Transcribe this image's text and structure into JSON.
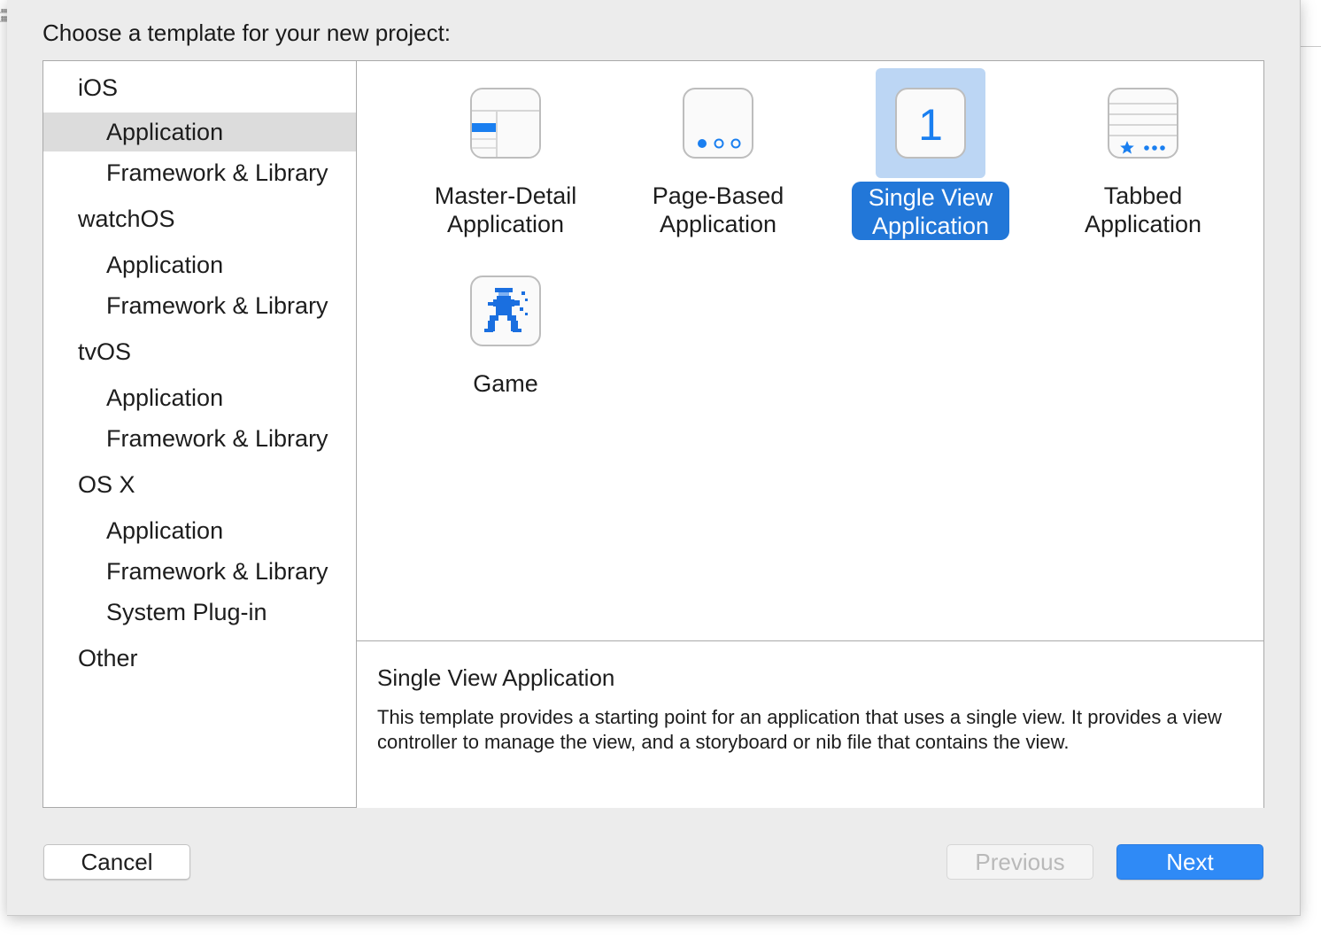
{
  "window": {
    "prompt": "Choose a template for your new project:"
  },
  "sidebar": {
    "items": [
      {
        "label": "iOS",
        "type": "header"
      },
      {
        "label": "Application",
        "type": "item",
        "selected": true
      },
      {
        "label": "Framework & Library",
        "type": "item"
      },
      {
        "label": "watchOS",
        "type": "header"
      },
      {
        "label": "Application",
        "type": "item"
      },
      {
        "label": "Framework & Library",
        "type": "item"
      },
      {
        "label": "tvOS",
        "type": "header"
      },
      {
        "label": "Application",
        "type": "item"
      },
      {
        "label": "Framework & Library",
        "type": "item"
      },
      {
        "label": "OS X",
        "type": "header"
      },
      {
        "label": "Application",
        "type": "item"
      },
      {
        "label": "Framework & Library",
        "type": "item"
      },
      {
        "label": "System Plug-in",
        "type": "item"
      },
      {
        "label": "Other",
        "type": "header"
      }
    ]
  },
  "templates": [
    {
      "line1": "Master-Detail",
      "line2": "Application",
      "icon": "master-detail-icon"
    },
    {
      "line1": "Page-Based",
      "line2": "Application",
      "icon": "page-based-icon"
    },
    {
      "line1": "Single View",
      "line2": "Application",
      "icon": "single-view-icon",
      "selected": true,
      "glyph": "1"
    },
    {
      "line1": "Tabbed",
      "line2": "Application",
      "icon": "tabbed-icon"
    },
    {
      "line1": "Game",
      "line2": "",
      "icon": "game-icon"
    }
  ],
  "description": {
    "title": "Single View Application",
    "body": "This template provides a starting point for an application that uses a single view. It provides a view controller to manage the view, and a storyboard or nib file that contains the view."
  },
  "buttons": {
    "cancel": "Cancel",
    "previous": "Previous",
    "next": "Next"
  },
  "colors": {
    "accent": "#2f8af6",
    "selection": "#2277d8",
    "icon_blue": "#1a7ff0"
  }
}
